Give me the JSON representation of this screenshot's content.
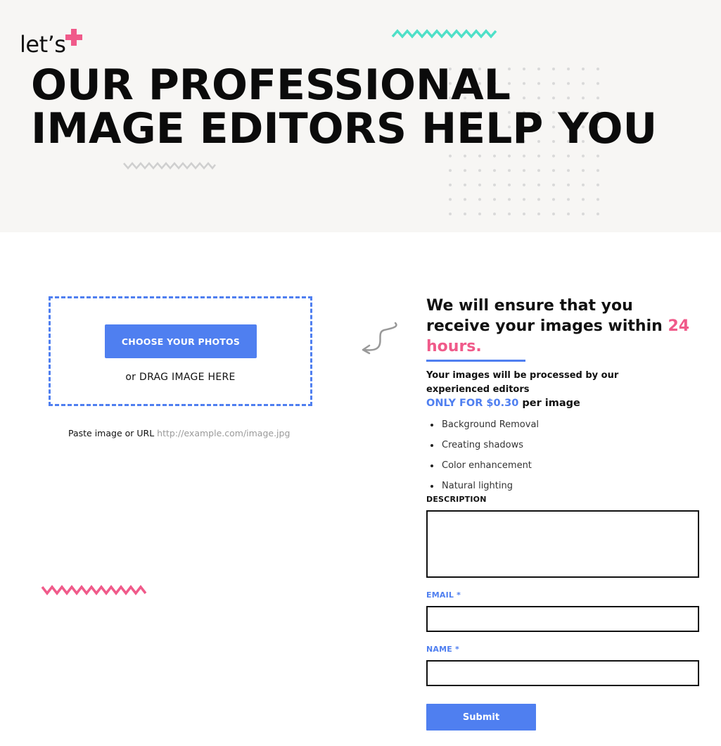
{
  "hero": {
    "logo_text": "let’s",
    "title_line1": "OUR PROFESSIONAL",
    "title_line2": "IMAGE EDITORS HELP YOU"
  },
  "upload": {
    "choose_label": "CHOOSE YOUR PHOTOS",
    "drag_label": "or DRAG IMAGE HERE",
    "paste_label": "Paste image or URL",
    "paste_placeholder": "http://example.com/image.jpg"
  },
  "info": {
    "headline_part1": "We will ensure that you receive your images within ",
    "headline_accent": "24 hours.",
    "subtext": "Your images will be processed by our experienced editors",
    "price_prefix": "ONLY FOR $0.30",
    "price_suffix": " per image",
    "features": [
      "Background Removal",
      "Creating shadows",
      "Color enhancement",
      "Natural lighting"
    ]
  },
  "form": {
    "description_label": "DESCRIPTION",
    "email_label": "EMAIL *",
    "name_label": "NAME *",
    "submit_label": "Submit"
  },
  "colors": {
    "accent_blue": "#4f7ff0",
    "accent_pink": "#f05a8a",
    "accent_teal": "#4fe0c8",
    "hero_bg": "#f7f6f4"
  },
  "icons": {
    "logo_plus": "plus-icon",
    "curly_arrow": "curved-arrow-icon"
  }
}
